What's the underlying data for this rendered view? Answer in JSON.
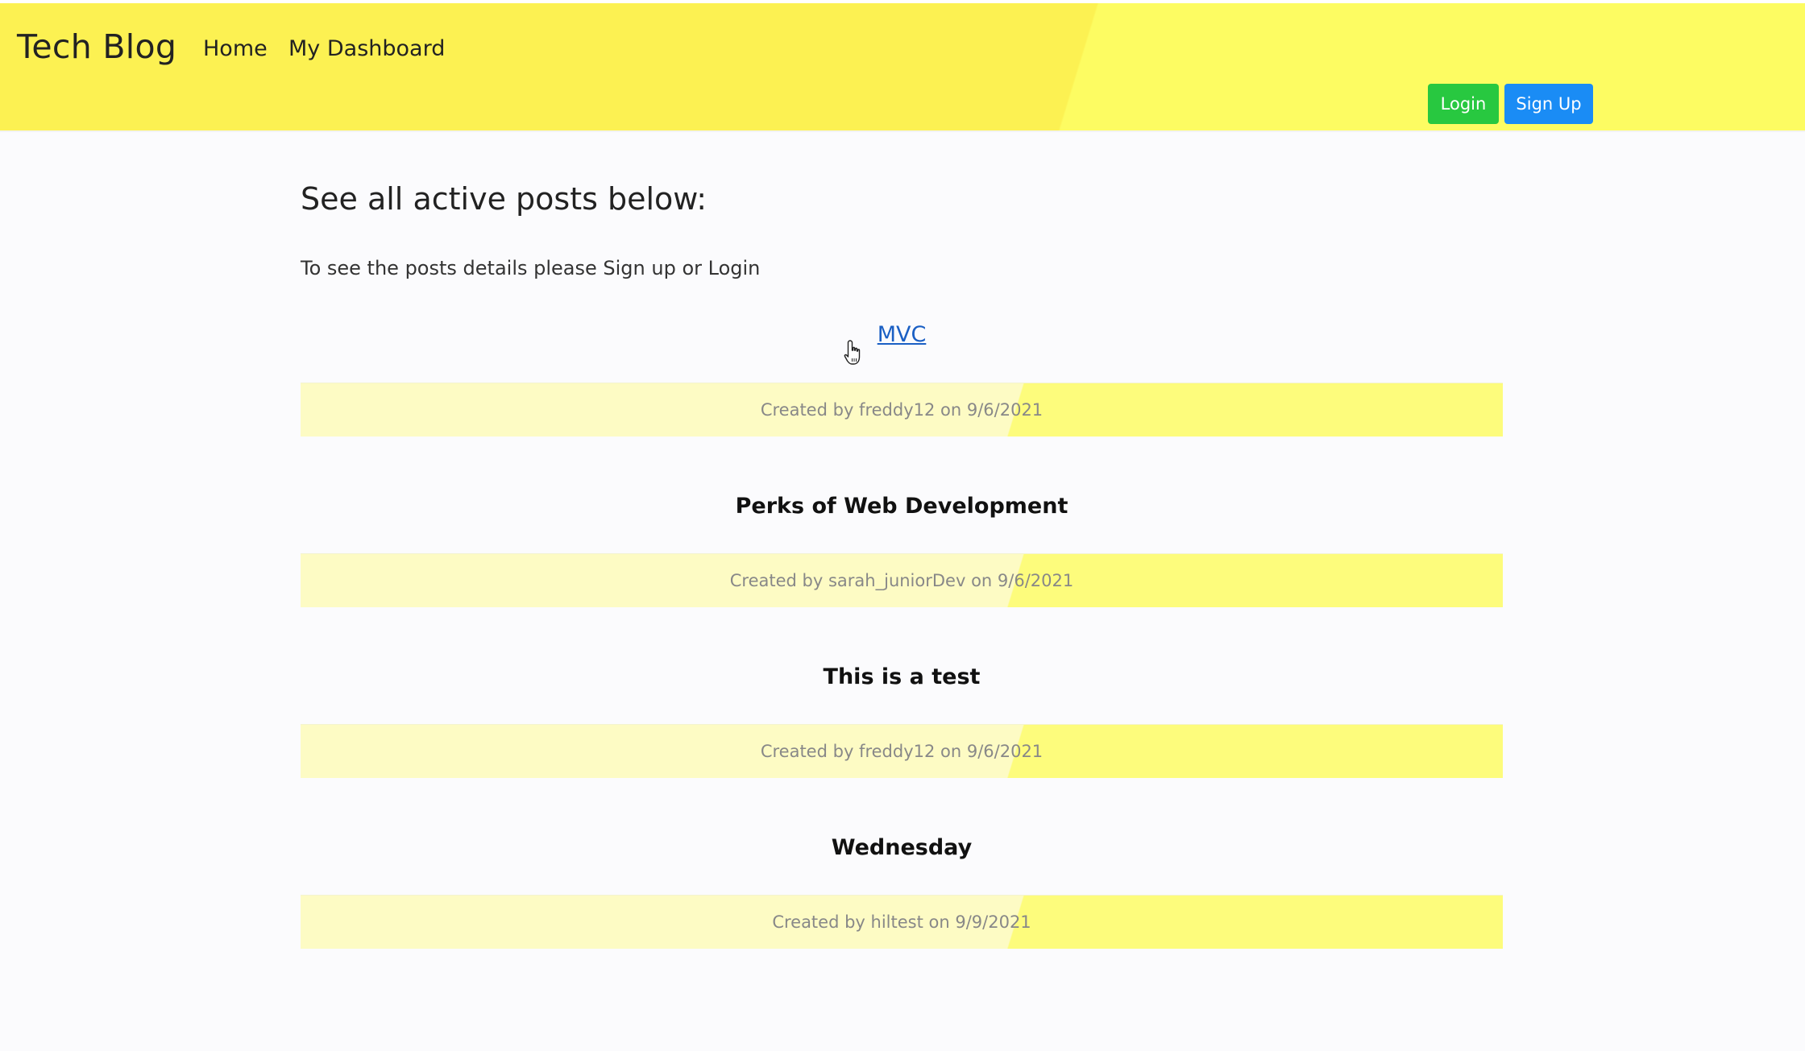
{
  "navbar": {
    "brand": "Tech Blog",
    "links": [
      {
        "label": "Home"
      },
      {
        "label": "My Dashboard"
      }
    ],
    "login_label": "Login",
    "signup_label": "Sign Up"
  },
  "main": {
    "heading": "See all active posts below:",
    "intro": "To see the posts details please Sign up or Login"
  },
  "posts": [
    {
      "title": "MVC",
      "meta": "Created by freddy12 on 9/6/2021"
    },
    {
      "title": "Perks of Web Development",
      "meta": "Created by sarah_juniorDev on 9/6/2021"
    },
    {
      "title": "This is a test",
      "meta": "Created by freddy12 on 9/6/2021"
    },
    {
      "title": "Wednesday",
      "meta": "Created by hiltest on 9/9/2021"
    }
  ],
  "colors": {
    "navbar_yellow": "#fcf152",
    "login_green": "#28c840",
    "signup_blue": "#1a8cf5",
    "link_blue": "#1a5fc4"
  },
  "icons": {
    "cursor": "hand-pointer-cursor"
  }
}
